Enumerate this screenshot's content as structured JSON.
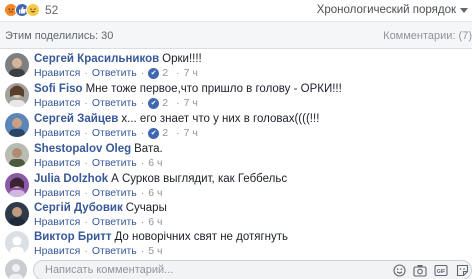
{
  "reactions": {
    "count": "52"
  },
  "sort": {
    "label": "Хронологический порядок"
  },
  "stats": {
    "shares": "Этим поделились: 30",
    "comments": "Комментарии: (7)"
  },
  "actions": {
    "like": "Нравится",
    "reply": "Ответить",
    "separator": "·"
  },
  "comments": [
    {
      "author": "Сергей Красильников",
      "text": "Орки!!!!",
      "likes": "2",
      "time": "7 ч"
    },
    {
      "author": "Sofi Fiso",
      "text": "Мне тоже первое,что пришло в голову - ОРКИ!!!",
      "likes": "2",
      "time": "7 ч"
    },
    {
      "author": "Сергей Зайцев",
      "text": "х... его знает что у них в головах((((!!!",
      "likes": "2",
      "time": "7 ч"
    },
    {
      "author": "Shestopalov Oleg",
      "text": "Вата.",
      "time": "6 ч"
    },
    {
      "author": "Julia Dolzhok",
      "text": "А Сурков выглядит, как Геббельс",
      "time": "6 ч"
    },
    {
      "author": "Сергій Дубовик",
      "text": "Сучары",
      "time": "6 ч"
    },
    {
      "author": "Виктор Бритт",
      "text": "До новорічних свят не дотягнуть",
      "time": "5 ч"
    }
  ],
  "composer": {
    "placeholder": "Написать комментарий..."
  },
  "colors": {
    "link": "#385898",
    "meta": "#90949c",
    "like_blue": "#4267b2"
  }
}
